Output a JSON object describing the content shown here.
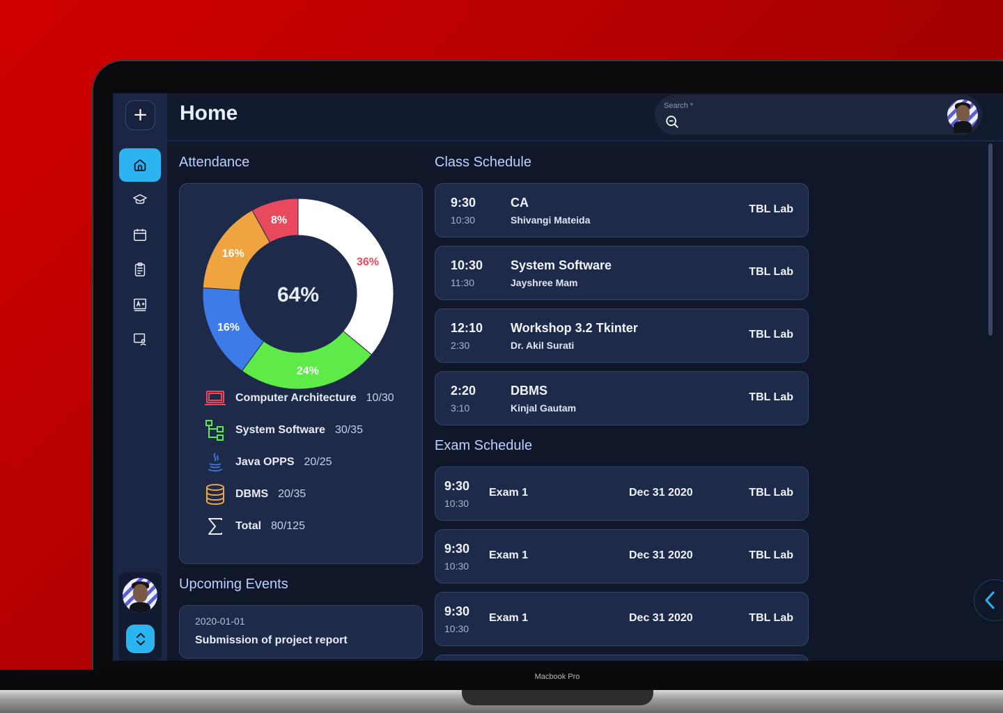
{
  "device_label": "Macbook Pro",
  "header": {
    "title": "Home",
    "search_label": "Search *",
    "search_value": ""
  },
  "sidebar": {
    "items": [
      {
        "name": "home",
        "active": true
      },
      {
        "name": "courses"
      },
      {
        "name": "calendar"
      },
      {
        "name": "assignments"
      },
      {
        "name": "grades"
      },
      {
        "name": "classroom"
      }
    ]
  },
  "attendance": {
    "title": "Attendance",
    "center_label": "64%",
    "subjects": [
      {
        "name": "Computer Architecture",
        "value": "10/30",
        "icon": "laptop-icon",
        "color": "#e8495c"
      },
      {
        "name": "System Software",
        "value": "30/35",
        "icon": "tree-icon",
        "color": "#5eea47"
      },
      {
        "name": "Java OPPS",
        "value": "20/25",
        "icon": "java-icon",
        "color": "#3c7be8"
      },
      {
        "name": "DBMS",
        "value": "20/35",
        "icon": "database-icon",
        "color": "#f0a440"
      },
      {
        "name": "Total",
        "value": "80/125",
        "icon": "sigma-icon",
        "color": "#e8ecf7"
      }
    ]
  },
  "chart_data": {
    "type": "pie",
    "title": "",
    "center_label": "64%",
    "slices": [
      {
        "label": "36%",
        "value": 36,
        "color": "#ffffff",
        "label_color": "#e8495c"
      },
      {
        "label": "24%",
        "value": 24,
        "color": "#5eea47",
        "label_color": "#ffffff"
      },
      {
        "label": "16%",
        "value": 16,
        "color": "#3c7be8",
        "label_color": "#ffffff"
      },
      {
        "label": "16%",
        "value": 16,
        "color": "#f0a440",
        "label_color": "#ffffff"
      },
      {
        "label": "8%",
        "value": 8,
        "color": "#e8495c",
        "label_color": "#ffffff"
      }
    ]
  },
  "events": {
    "title": "Upcoming Events",
    "items": [
      {
        "date": "2020-01-01",
        "text": "Submission of project report"
      }
    ]
  },
  "class_schedule": {
    "title": "Class Schedule",
    "items": [
      {
        "start": "9:30",
        "end": "10:30",
        "title": "CA",
        "teacher": "Shivangi Mateida",
        "room": "TBL Lab"
      },
      {
        "start": "10:30",
        "end": "11:30",
        "title": "System Software",
        "teacher": "Jayshree Mam",
        "room": "TBL Lab"
      },
      {
        "start": "12:10",
        "end": "2:30",
        "title": "Workshop 3.2 Tkinter",
        "teacher": "Dr. Akil Surati",
        "room": "TBL Lab"
      },
      {
        "start": "2:20",
        "end": "3:10",
        "title": "DBMS",
        "teacher": "Kinjal Gautam",
        "room": "TBL Lab"
      }
    ]
  },
  "exam_schedule": {
    "title": "Exam Schedule",
    "items": [
      {
        "start": "9:30",
        "end": "10:30",
        "name": "Exam 1",
        "date": "Dec 31 2020",
        "room": "TBL Lab"
      },
      {
        "start": "9:30",
        "end": "10:30",
        "name": "Exam 1",
        "date": "Dec 31 2020",
        "room": "TBL Lab"
      },
      {
        "start": "9:30",
        "end": "10:30",
        "name": "Exam 1",
        "date": "Dec 31 2020",
        "room": "TBL Lab"
      }
    ]
  },
  "colors": {
    "accent": "#2bb4ef",
    "card": "#1e2a49",
    "background": "#0f1729"
  }
}
